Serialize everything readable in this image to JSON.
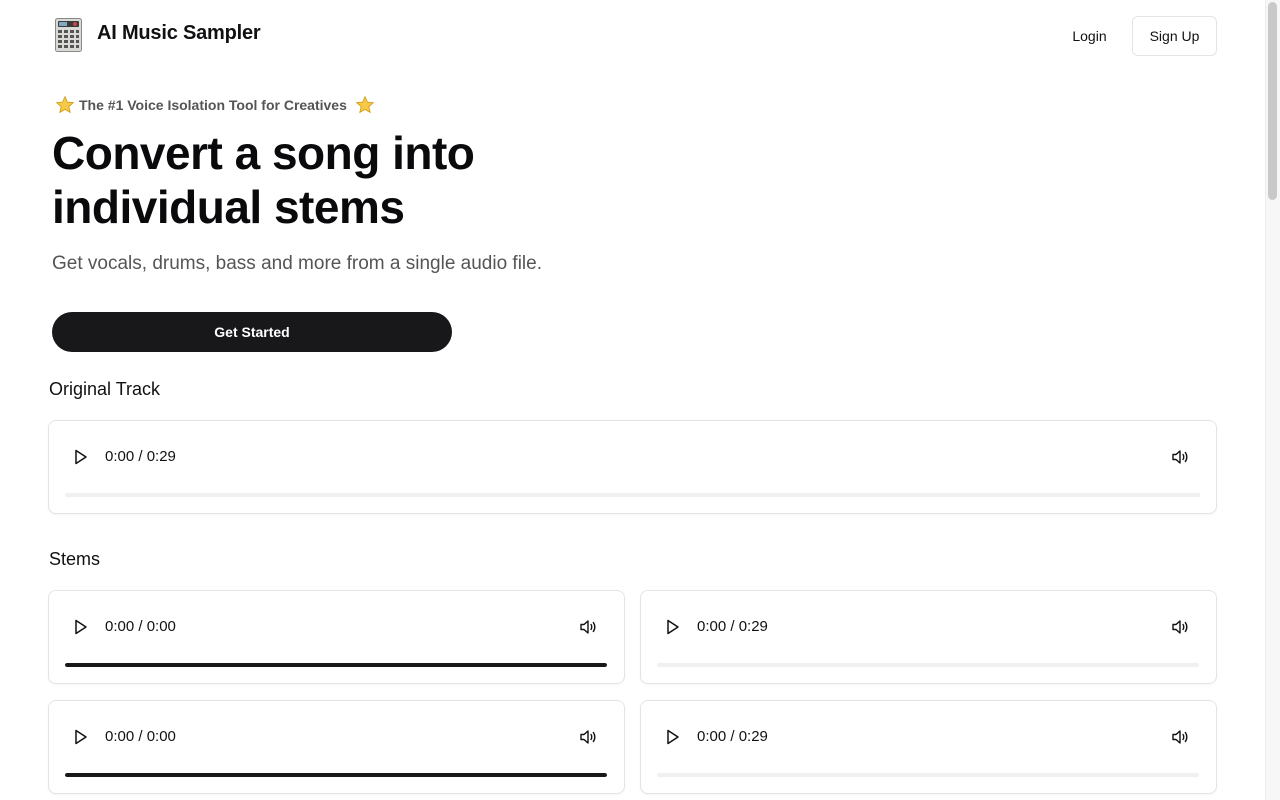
{
  "header": {
    "brand": "AI Music Sampler",
    "login_label": "Login",
    "signup_label": "Sign Up"
  },
  "hero": {
    "tagline": "The #1 Voice Isolation Tool for Creatives",
    "headline_line1": "Convert a song into",
    "headline_line2": "individual stems",
    "subhead": "Get vocals, drums, bass and more from a single audio file.",
    "cta_label": "Get Started"
  },
  "original": {
    "title": "Original Track",
    "player": {
      "time": "0:00 / 0:29",
      "progress": 0
    }
  },
  "stems": {
    "title": "Stems",
    "players": [
      {
        "time": "0:00 / 0:00",
        "progress": 1
      },
      {
        "time": "0:00 / 0:29",
        "progress": 0
      },
      {
        "time": "0:00 / 0:00",
        "progress": 1
      },
      {
        "time": "0:00 / 0:29",
        "progress": 0
      }
    ]
  },
  "icons": {
    "logo": "sampler-device-icon",
    "star": "star-icon",
    "play": "play-icon",
    "volume": "volume-icon"
  },
  "colors": {
    "primary": "#18181b",
    "border": "#e4e4e7",
    "star": "#f5c518",
    "muted_text": "#555555"
  }
}
